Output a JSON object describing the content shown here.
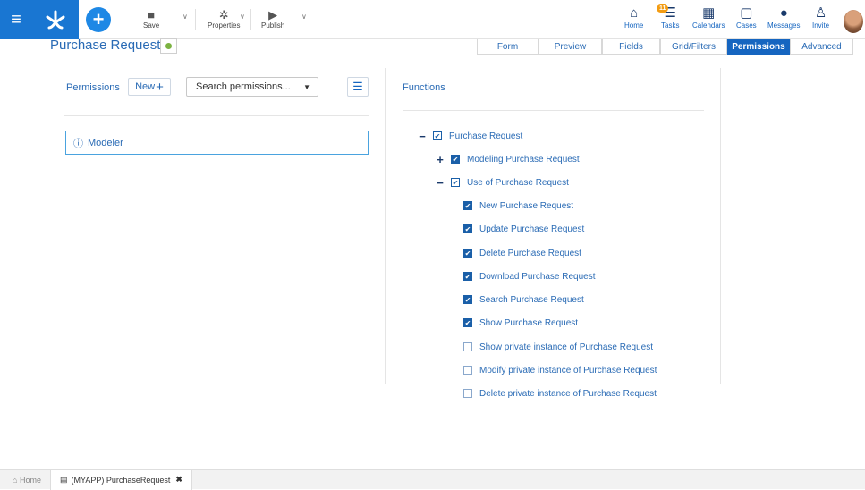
{
  "toolbar": {
    "save_label": "Save",
    "properties_label": "Properties",
    "publish_label": "Publish"
  },
  "nav": {
    "home_label": "Home",
    "tasks_label": "Tasks",
    "tasks_badge": "11",
    "calendars_label": "Calendars",
    "cases_label": "Cases",
    "messages_label": "Messages",
    "invite_label": "Invite"
  },
  "page": {
    "title": "Purchase Request"
  },
  "tabs": [
    "Form",
    "Preview",
    "Fields",
    "Grid/Filters",
    "Permissions",
    "Advanced"
  ],
  "active_tab": "Permissions",
  "permissions_panel": {
    "label": "Permissions",
    "new_label": "New",
    "search_placeholder": "Search permissions...",
    "roles": [
      "Modeler"
    ]
  },
  "functions_panel": {
    "label": "Functions",
    "tree": [
      {
        "label": "Purchase Request",
        "toggle": "−",
        "checked": "partial"
      },
      {
        "label": "Modeling Purchase Request",
        "toggle": "+",
        "checked": "full"
      },
      {
        "label": "Use of Purchase Request",
        "toggle": "−",
        "checked": "partial"
      },
      {
        "label": "New Purchase Request",
        "checked": "full"
      },
      {
        "label": "Update Purchase Request",
        "checked": "full"
      },
      {
        "label": "Delete Purchase Request",
        "checked": "full"
      },
      {
        "label": "Download Purchase Request",
        "checked": "full"
      },
      {
        "label": "Search Purchase Request",
        "checked": "full"
      },
      {
        "label": "Show Purchase Request",
        "checked": "full"
      },
      {
        "label": "Show private instance of Purchase Request",
        "checked": "none"
      },
      {
        "label": "Modify private instance of Purchase Request",
        "checked": "none"
      },
      {
        "label": "Delete private instance of Purchase Request",
        "checked": "none"
      }
    ]
  },
  "statusbar": {
    "home_label": "Home",
    "open_tab_label": "(MYAPP) PurchaseRequest"
  },
  "colors": {
    "primary": "#1976d2",
    "accent_blue": "#2a6bb5",
    "active_tab": "#1565c0",
    "status_green": "#7cb342",
    "badge": "#f39c12"
  }
}
